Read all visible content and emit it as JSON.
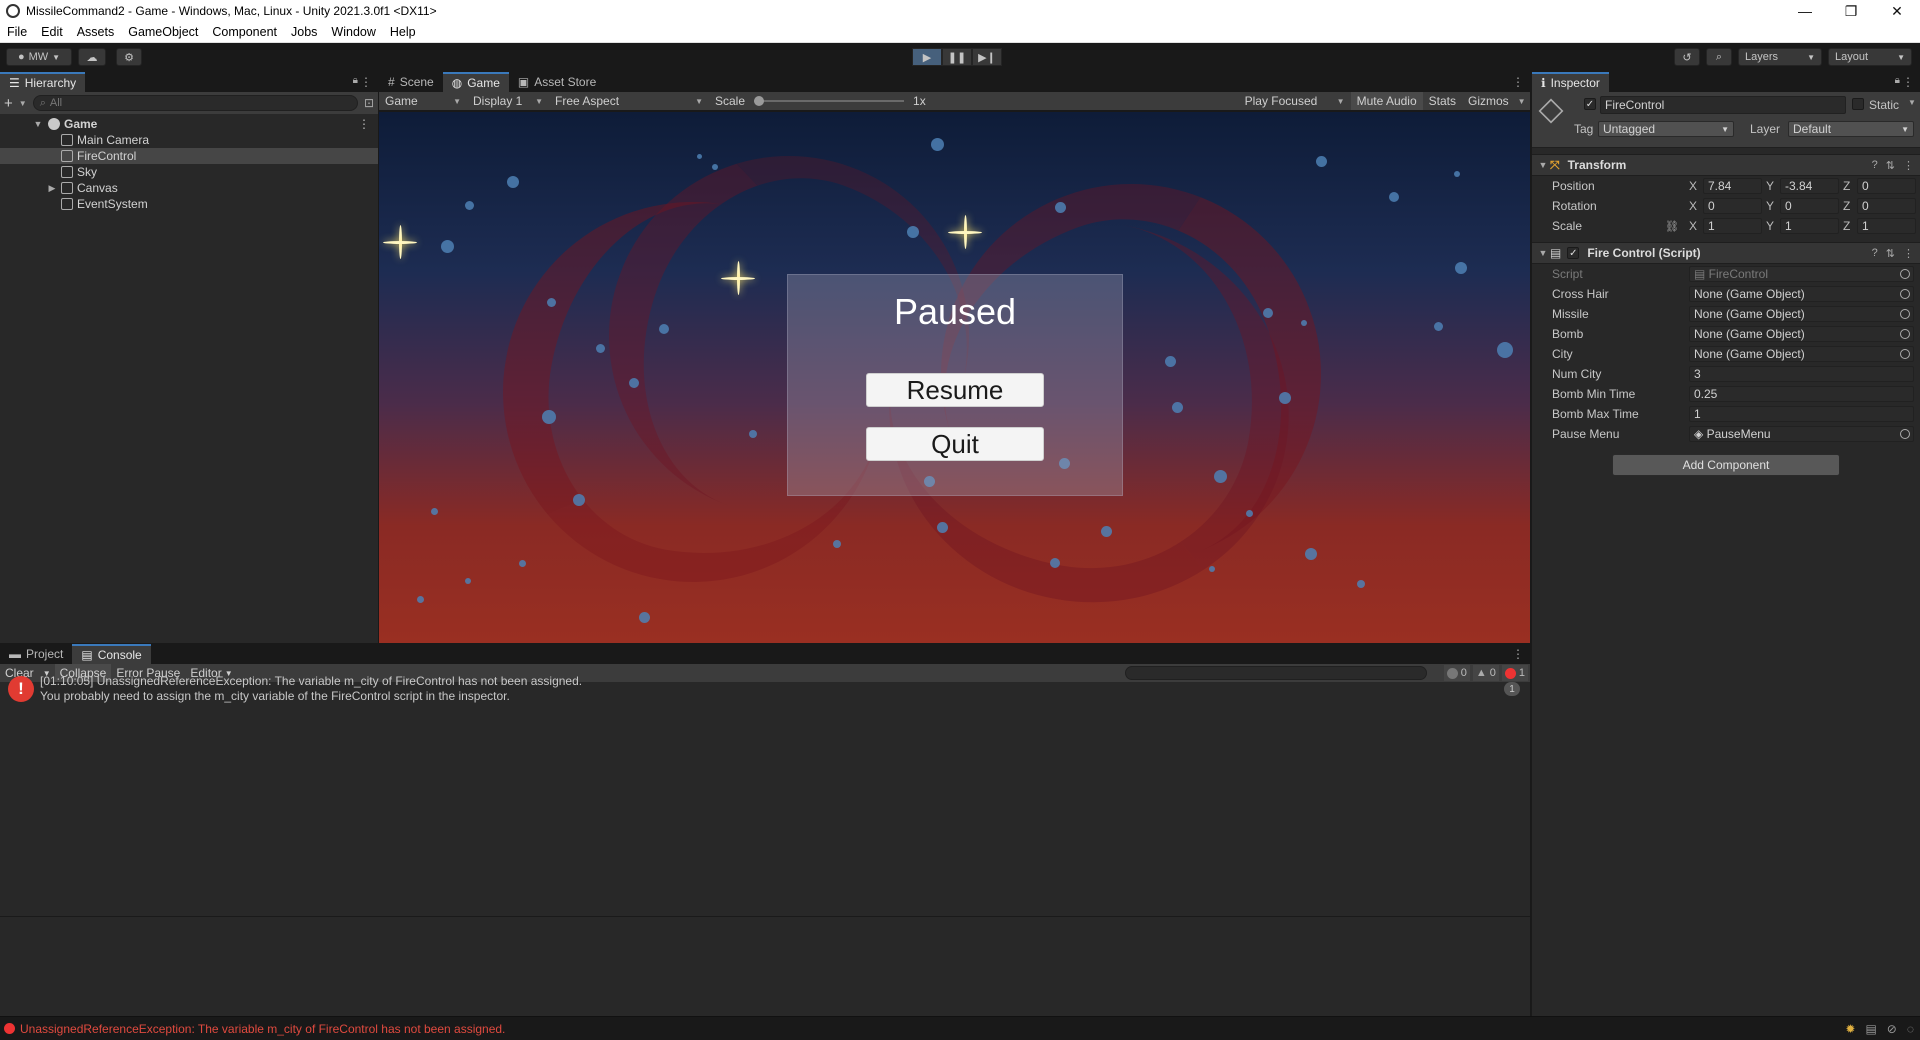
{
  "window": {
    "title": "MissileCommand2 - Game - Windows, Mac, Linux - Unity 2021.3.0f1 <DX11>",
    "minimize": "—",
    "maximize": "❐",
    "close": "✕"
  },
  "menu": [
    "File",
    "Edit",
    "Assets",
    "GameObject",
    "Component",
    "Jobs",
    "Window",
    "Help"
  ],
  "toolbar": {
    "account": "MW",
    "layers": "Layers",
    "layout": "Layout"
  },
  "hierarchy": {
    "tab": "Hierarchy",
    "search_placeholder": "All",
    "scene": "Game",
    "items": [
      "Main Camera",
      "FireControl",
      "Sky",
      "Canvas",
      "EventSystem"
    ]
  },
  "center_tabs": [
    "Scene",
    "Game",
    "Asset Store"
  ],
  "game_toolbar": {
    "mode": "Game",
    "display": "Display 1",
    "aspect": "Free Aspect",
    "scale_label": "Scale",
    "scale_value": "1x",
    "play_focused": "Play Focused",
    "mute_audio": "Mute Audio",
    "stats": "Stats",
    "gizmos": "Gizmos"
  },
  "pause_menu": {
    "title": "Paused",
    "resume": "Resume",
    "quit": "Quit"
  },
  "bottom_tabs": [
    "Project",
    "Console"
  ],
  "console": {
    "clear": "Clear",
    "collapse": "Collapse",
    "error_pause": "Error Pause",
    "editor": "Editor",
    "counts": {
      "info": "0",
      "warn": "0",
      "error": "1"
    },
    "entry_line1": "[01:10:05] UnassignedReferenceException: The variable m_city of FireControl has not been assigned.",
    "entry_line2": "You probably need to assign the m_city variable of the FireControl script in the inspector.",
    "entry_count": "1"
  },
  "status": {
    "message": "UnassignedReferenceException: The variable m_city of FireControl has not been assigned."
  },
  "inspector": {
    "tab": "Inspector",
    "object_name": "FireControl",
    "static_label": "Static",
    "tag_label": "Tag",
    "tag_value": "Untagged",
    "layer_label": "Layer",
    "layer_value": "Default",
    "transform": {
      "title": "Transform",
      "position_label": "Position",
      "rotation_label": "Rotation",
      "scale_label": "Scale",
      "position": {
        "x": "7.84",
        "y": "-3.84",
        "z": "0"
      },
      "rotation": {
        "x": "0",
        "y": "0",
        "z": "0"
      },
      "scale": {
        "x": "1",
        "y": "1",
        "z": "1"
      }
    },
    "script_component": {
      "title": "Fire Control (Script)",
      "script_label": "Script",
      "script_value": "FireControl",
      "props": [
        {
          "label": "Cross Hair",
          "value": "None (Game Object)"
        },
        {
          "label": "Missile",
          "value": "None (Game Object)"
        },
        {
          "label": "Bomb",
          "value": "None (Game Object)"
        },
        {
          "label": "City",
          "value": "None (Game Object)"
        },
        {
          "label": "Num City",
          "value": "3"
        },
        {
          "label": "Bomb Min Time",
          "value": "0.25"
        },
        {
          "label": "Bomb Max Time",
          "value": "1"
        },
        {
          "label": "Pause Menu",
          "value": "PauseMenu"
        }
      ]
    },
    "add_component": "Add Component"
  },
  "colors": {
    "accent": "#3a79bb",
    "error": "#e13b32",
    "panel": "#282828"
  }
}
